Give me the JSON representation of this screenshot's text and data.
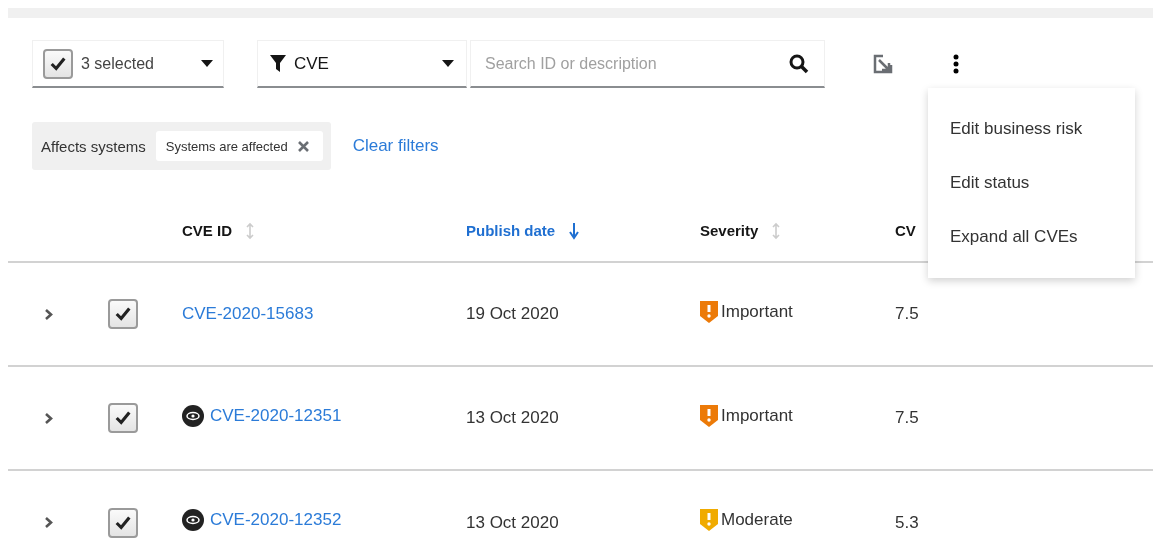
{
  "toolbar": {
    "bulk_select": {
      "label": "3 selected",
      "checked": true
    },
    "filter": {
      "label": "CVE"
    },
    "search": {
      "placeholder": "Search ID or description"
    }
  },
  "kebab_menu": {
    "expanded": true,
    "items": [
      "Edit business risk",
      "Edit status",
      "Expand all CVEs"
    ]
  },
  "filter_chips": {
    "category": "Affects systems",
    "chips": [
      "Systems are affected"
    ],
    "clear": "Clear filters"
  },
  "table": {
    "columns": [
      {
        "label": "CVE ID",
        "sorted": false
      },
      {
        "label": "Publish date",
        "sorted": true
      },
      {
        "label": "Severity",
        "sorted": false
      },
      {
        "label": "CV",
        "sorted": false
      }
    ],
    "rows": [
      {
        "expanded": false,
        "checked": true,
        "flagged": false,
        "cve": "CVE-2020-15683",
        "date": "19 Oct 2020",
        "severity": "Important",
        "color": "#ec7a08",
        "cvss": "7.5"
      },
      {
        "expanded": false,
        "checked": true,
        "flagged": true,
        "cve": "CVE-2020-12351",
        "date": "13 Oct 2020",
        "severity": "Important",
        "color": "#ec7a08",
        "cvss": "7.5"
      },
      {
        "expanded": false,
        "checked": true,
        "flagged": true,
        "cve": "CVE-2020-12352",
        "date": "13 Oct 2020",
        "severity": "Moderate",
        "color": "#f0ab00",
        "cvss": "5.3"
      }
    ]
  }
}
